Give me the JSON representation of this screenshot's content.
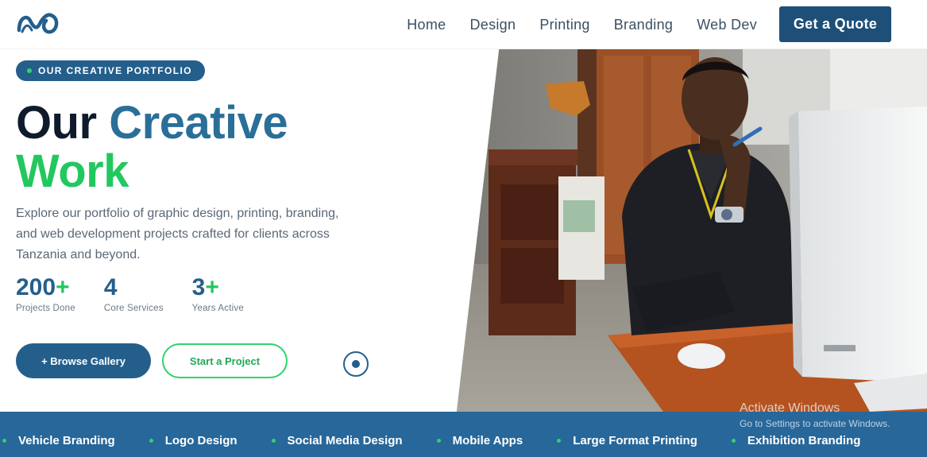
{
  "brand": {
    "logo": "spring-logo-icon",
    "colors": {
      "primary": "#245f8c",
      "navy": "#1e4f78",
      "accent_green": "#22c85f",
      "dark": "#0f1b2b"
    }
  },
  "nav": {
    "links": [
      "Home",
      "Design",
      "Printing",
      "Branding",
      "Web Dev"
    ],
    "cta": "Get a Quote"
  },
  "hero": {
    "badge": "OUR CREATIVE PORTFOLIO",
    "title_word1": "Our",
    "title_word2": "Creative",
    "title_word3": "Work",
    "lead": "Explore our portfolio of graphic design, printing, branding, and web development projects crafted for clients across Tanzania and beyond.",
    "stats": [
      {
        "value": "200",
        "suffix": "+",
        "label": "Projects Done"
      },
      {
        "value": "4",
        "suffix": "",
        "label": "Core Services"
      },
      {
        "value": "3",
        "suffix": "+",
        "label": "Years Active"
      }
    ],
    "primary_button": "+ Browse Gallery",
    "secondary_button": "Start a Project",
    "scroll_icon": "scroll-indicator-icon"
  },
  "services_strip": [
    "Vehicle Branding",
    "Logo Design",
    "Social Media Design",
    "Mobile Apps",
    "Large Format Printing",
    "Exhibition Branding"
  ],
  "watermark": {
    "line1": "Activate Windows",
    "line2": "Go to Settings to activate Windows."
  }
}
